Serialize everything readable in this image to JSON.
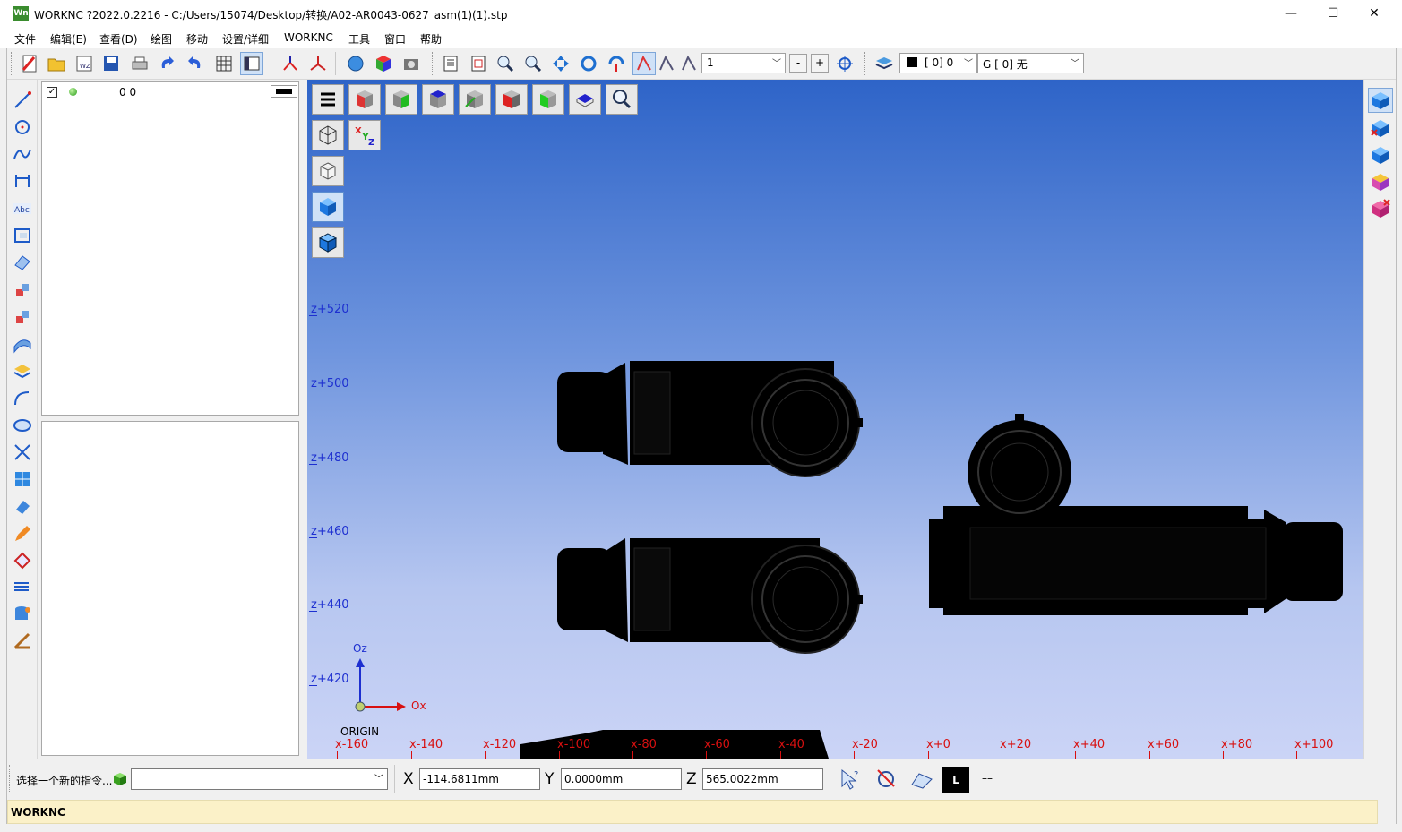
{
  "window": {
    "app_icon_text": "Wn",
    "title": "WORKNC ?2022.0.2216 - C:/Users/15074/Desktop/转换/A02-AR0043-0627_asm(1)(1).stp",
    "minimize": "—",
    "maximize": "☐",
    "close": "✕"
  },
  "menu": [
    "文件",
    "编辑(E)",
    "查看(D)",
    "绘图",
    "移动",
    "设置/详细",
    "WORKNC",
    "工具",
    "窗口",
    "帮助"
  ],
  "toolbar": {
    "combo_value": "1",
    "minus_label": "-",
    "plus_label": "+",
    "layer_combo": "[    0] 0",
    "group_combo": "G [    0] 无"
  },
  "layers": {
    "row": {
      "checked": true,
      "label": "0 0",
      "color": "#000000"
    }
  },
  "viewport": {
    "z_labels": [
      "z+520",
      "z+500",
      "z+480",
      "z+460",
      "z+440",
      "z+420"
    ],
    "x_labels": [
      "x-160",
      "x-140",
      "x-120",
      "x-100",
      "x-80",
      "x-60",
      "x-40",
      "x-20",
      "x+0",
      "x+20",
      "x+40",
      "x+60",
      "x+80",
      "x+100"
    ],
    "axis_oz": "Oz",
    "axis_ox": "Ox",
    "origin_label": "ORIGIN",
    "bg_top": "#2e64c8",
    "bg_bottom": "#cbd4f6",
    "axis_z_color": "#1d2fd0",
    "axis_x_color": "#d81010"
  },
  "command": {
    "prompt": "选择一个新的指令...",
    "input_value": "",
    "x_label": "X",
    "x_value": "-114.6811mm",
    "y_label": "Y",
    "y_value": "0.0000mm",
    "z_label": "Z",
    "z_value": "565.0022mm",
    "mode_label": "L",
    "mode_extra": "––"
  },
  "status": {
    "text": "WORKNC"
  }
}
